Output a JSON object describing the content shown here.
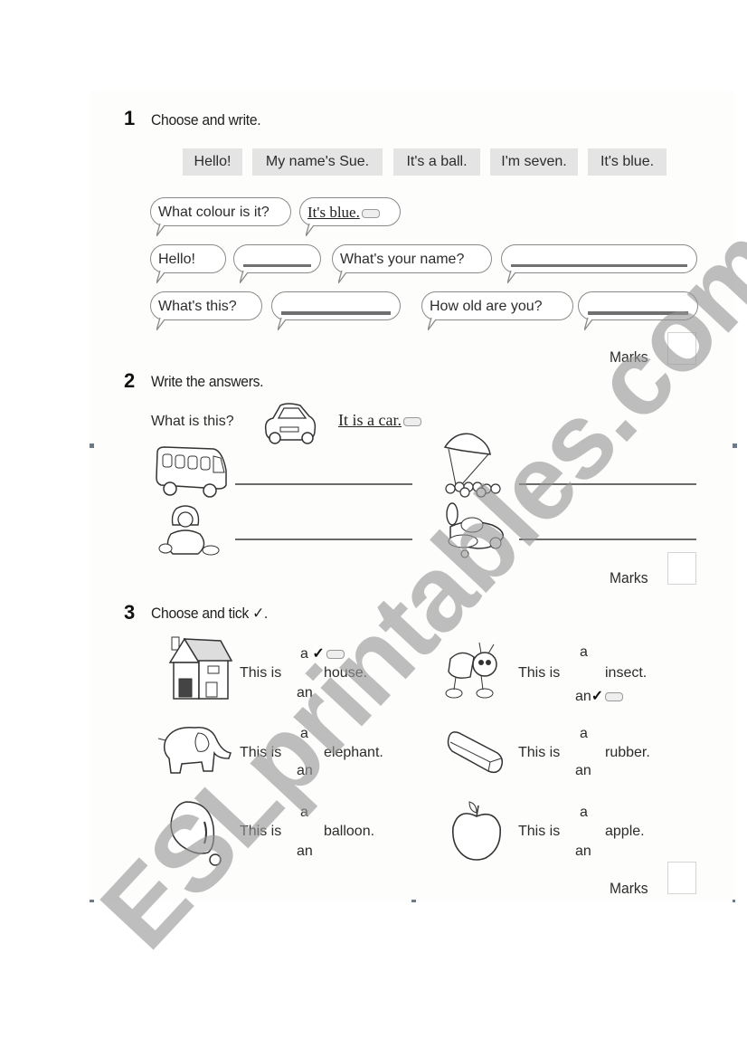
{
  "section1": {
    "number": "1",
    "title": "Choose and write.",
    "options": [
      "Hello!",
      "My name's Sue.",
      "It's a ball.",
      "I'm seven.",
      "It's blue."
    ],
    "example": {
      "question": "What colour is it?",
      "answer": "It's blue."
    },
    "dialogues": [
      {
        "question": "Hello!",
        "answer": ""
      },
      {
        "question": "What's your name?",
        "answer": ""
      },
      {
        "question": "What's this?",
        "answer": ""
      },
      {
        "question": "How old are you?",
        "answer": ""
      }
    ],
    "marks_label": "Marks"
  },
  "section2": {
    "number": "2",
    "title": "Write the answers.",
    "example_question": "What is this?",
    "example_answer": "It is a car.",
    "pictures": [
      "bus",
      "parachute",
      "doll",
      "plane"
    ],
    "marks_label": "Marks"
  },
  "section3": {
    "number": "3",
    "title": "Choose and tick ✓.",
    "items": [
      {
        "prefix": "This is",
        "opt_a": "a",
        "opt_an": "an",
        "noun": "house.",
        "ticked": "a",
        "picture": "house"
      },
      {
        "prefix": "This is",
        "opt_a": "a",
        "opt_an": "an",
        "noun": "insect.",
        "ticked": "an",
        "picture": "insect"
      },
      {
        "prefix": "This is",
        "opt_a": "a",
        "opt_an": "an",
        "noun": "elephant.",
        "ticked": "",
        "picture": "elephant"
      },
      {
        "prefix": "This is",
        "opt_a": "a",
        "opt_an": "an",
        "noun": "rubber.",
        "ticked": "",
        "picture": "rubber"
      },
      {
        "prefix": "This is",
        "opt_a": "a",
        "opt_an": "an",
        "noun": "balloon.",
        "ticked": "",
        "picture": "balloon"
      },
      {
        "prefix": "This is",
        "opt_a": "a",
        "opt_an": "an",
        "noun": "apple.",
        "ticked": "",
        "picture": "apple"
      }
    ],
    "tick_glyph": "✓",
    "marks_label": "Marks"
  },
  "watermark": "ESLprintables.com"
}
